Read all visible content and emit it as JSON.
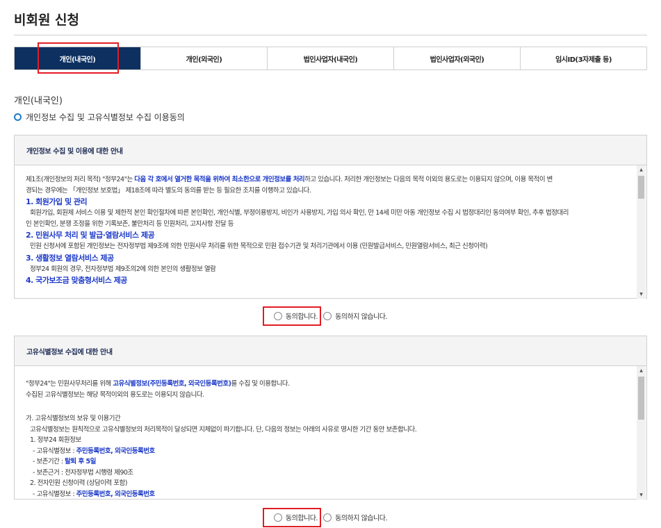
{
  "page_title": "비회원 신청",
  "tabs": [
    {
      "label": "개인(내국인)",
      "active": true
    },
    {
      "label": "개인(외국인)",
      "active": false
    },
    {
      "label": "법인사업자(내국인)",
      "active": false
    },
    {
      "label": "법인사업자(외국인)",
      "active": false
    },
    {
      "label": "임시ID(3자제출 등)",
      "active": false
    }
  ],
  "section_label": "개인(내국인)",
  "consent_title": "개인정보 수집 및 고유식별정보 수집 이용동의",
  "privacy": {
    "heading": "개인정보 수집 및 이용에 대한 안내",
    "intro_pre": "제1조(개인정보의 처리 목적) \"정부24\"는 ",
    "intro_bold": "다음 각 호에서 열거한 목적을 위하여 최소한으로 개인정보를 처리",
    "intro_post": "하고 있습니다. 처리한 개인정보는 다음의 목적 이외의 용도로는 이용되지 않으며, 이용 목적이 변",
    "intro_line2": "경되는 경우에는 「개인정보 보호법」 제18조에 따라 별도의 동의를 받는 등 필요한 조치를 이행하고 있습니다.",
    "item1_title": "1. 회원가입 및 관리",
    "item1_l1": "회원가입, 회원제 서비스 이용 및 제한적 본인 확인절차에 따른 본인확인, 개인식별, 부정이용방지, 비인가 사용방지, 가입 의사 확인, 만 14세 미만 아동 개인정보 수집 시 법정대리인 동의여부 확인, 추후 법정대리",
    "item1_l2": "인 본인확인, 분쟁 조정을 위한 기록보존, 불만처리 등 민원처리, 고지사항 전달 등",
    "item2_title": "2. 민원사무 처리 및 발급·열람서비스 제공",
    "item2_l1": "민원 신청서에 포함된 개인정보는 전자정부법 제9조에 의한 민원사무 처리를 위한 목적으로 민원 접수기관 및 처리기관에서 이용 (민원발급서비스, 민원열람서비스, 최근 신청이력)",
    "item3_title": "3. 생활정보 열람서비스 제공",
    "item3_l1": "정부24 회원의 경우, 전자정부법 제9조의2에 의한 본인의 생활정보 열람",
    "item4_title": "4. 국가보조금 맞춤형서비스 제공"
  },
  "unique": {
    "heading": "고유식별정보 수집에 대한 안내",
    "l1_pre": "\"정부24\"는 민원사무처리를 위해 ",
    "l1_bold": "고유식별정보(주민등록번호, 외국인등록번호)",
    "l1_post": "를 수집 및 이용합니다.",
    "l2": "수집된 고유식별정보는 해당 목적이외의 용도로는 이용되지 않습니다.",
    "l3": "가. 고유식별정보의 보유 및 이용기간",
    "l4": "고유식별정보는 원칙적으로 고유식별정보의 처리목적이 달성되면 지체없이 파기합니다. 단, 다음의 정보는 아래의 사유로 명시한 기간 동안 보존합니다.",
    "l5": "1. 정부24 회원정보",
    "l6_pre": "- 고유식별정보 : ",
    "l6_bold": "주민등록번호, 외국인등록번호",
    "l7_pre": "- 보존기간 : ",
    "l7_bold": "탈퇴 후 5일",
    "l8": "- 보존근거 : 전자정부법 시행령 제90조",
    "l9": "2. 전자민원 신청이력 (상담이력 포함)",
    "l10_pre": "- 고유식별정보 : ",
    "l10_bold": "주민등록번호, 외국인등록번호"
  },
  "radio": {
    "agree": "동의합니다.",
    "disagree": "동의하지 않습니다."
  },
  "colors": {
    "active_tab": "#0d3060",
    "highlight": "#e31b23",
    "emphasis": "#1d3ac8"
  }
}
